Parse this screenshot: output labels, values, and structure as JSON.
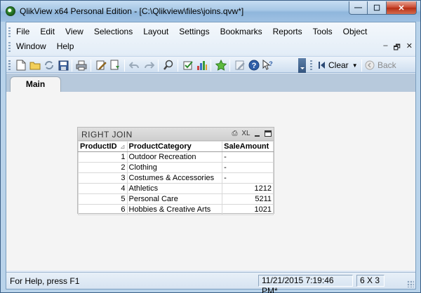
{
  "window": {
    "title": "QlikView x64 Personal Edition - [C:\\Qlikview\\files\\joins.qvw*]",
    "buttons": {
      "minimize": "—",
      "maximize": "☐",
      "close": "✕"
    }
  },
  "menubar": {
    "row1": [
      "File",
      "Edit",
      "View",
      "Selections",
      "Layout",
      "Settings",
      "Bookmarks",
      "Reports",
      "Tools",
      "Object"
    ],
    "row2": [
      "Window",
      "Help"
    ],
    "mdi_controls": {
      "minimize": "–",
      "restore": "🗗",
      "close": "✕"
    }
  },
  "toolbar": {
    "clear_label": "Clear",
    "back_label": "Back"
  },
  "tabs": [
    {
      "label": "Main"
    }
  ],
  "tablebox": {
    "caption": "RIGHT JOIN",
    "caption_icons": {
      "print": "⎙",
      "xl": "XL"
    },
    "columns": [
      "ProductID",
      "ProductCategory",
      "SaleAmount"
    ],
    "rows": [
      {
        "id": "1",
        "category": "Outdoor Recreation",
        "amount": "-"
      },
      {
        "id": "2",
        "category": "Clothing",
        "amount": "-"
      },
      {
        "id": "3",
        "category": "Costumes & Accessories",
        "amount": "-"
      },
      {
        "id": "4",
        "category": "Athletics",
        "amount": "1212"
      },
      {
        "id": "5",
        "category": "Personal Care",
        "amount": "5211"
      },
      {
        "id": "6",
        "category": "Hobbies & Creative Arts",
        "amount": "1021"
      }
    ]
  },
  "statusbar": {
    "help": "For Help, press F1",
    "timestamp": "11/21/2015 7:19:46 PM*",
    "dimensions": "6 X 3"
  }
}
